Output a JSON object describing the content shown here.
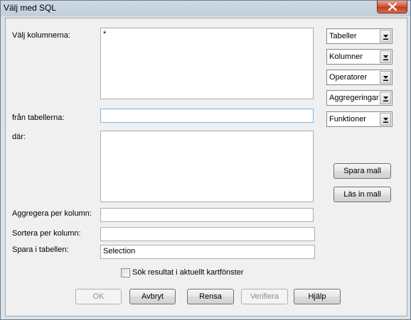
{
  "window": {
    "title": "Välj med SQL"
  },
  "labels": {
    "columns": "Välj kolumnerna:",
    "from_tables": "från tabellerna:",
    "where": "där:",
    "group_by": "Aggregera per kolumn:",
    "order_by": "Sortera per kolumn:",
    "into_table": "Spara i tabellen:"
  },
  "fields": {
    "columns_value": "*",
    "from_tables_value": "",
    "where_value": "",
    "group_by_value": "",
    "order_by_value": "",
    "into_table_value": "Selection"
  },
  "dropdowns": [
    {
      "label": "Tabeller"
    },
    {
      "label": "Kolumner"
    },
    {
      "label": "Operatorer"
    },
    {
      "label": "Aggregeringar"
    },
    {
      "label": "Funktioner"
    }
  ],
  "side_buttons": {
    "save_template": "Spara mall",
    "load_template": "Läs in mall"
  },
  "checkbox": {
    "label": "Sök resultat i aktuellt kartfönster",
    "checked": false
  },
  "buttons": {
    "ok": "OK",
    "cancel": "Avbryt",
    "clear": "Rensa",
    "verify": "Verifiera",
    "help": "Hjälp"
  }
}
